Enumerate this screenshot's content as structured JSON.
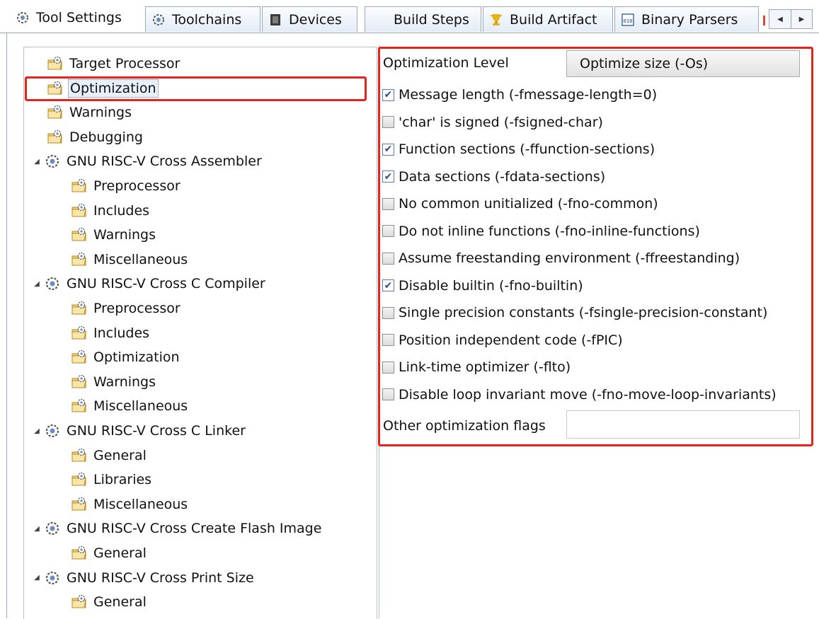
{
  "tabs": [
    {
      "label": "Tool Settings",
      "icon": "gear-folder-icon",
      "active": true
    },
    {
      "label": "Toolchains",
      "icon": "gear-icon"
    },
    {
      "label": "Devices",
      "icon": "chip-icon"
    },
    {
      "label": "Build Steps",
      "icon": ""
    },
    {
      "label": "Build Artifact",
      "icon": "trophy-icon"
    },
    {
      "label": "Binary Parsers",
      "icon": "binary-icon"
    }
  ],
  "tree": {
    "items": [
      {
        "label": "Target Processor",
        "level": 1
      },
      {
        "label": "Optimization",
        "level": 1,
        "selected": true
      },
      {
        "label": "Warnings",
        "level": 1
      },
      {
        "label": "Debugging",
        "level": 1
      },
      {
        "label": "GNU RISC-V Cross Assembler",
        "level": 0,
        "expanded": true
      },
      {
        "label": "Preprocessor",
        "level": 2
      },
      {
        "label": "Includes",
        "level": 2
      },
      {
        "label": "Warnings",
        "level": 2
      },
      {
        "label": "Miscellaneous",
        "level": 2
      },
      {
        "label": "GNU RISC-V Cross C Compiler",
        "level": 0,
        "expanded": true
      },
      {
        "label": "Preprocessor",
        "level": 2
      },
      {
        "label": "Includes",
        "level": 2
      },
      {
        "label": "Optimization",
        "level": 2
      },
      {
        "label": "Warnings",
        "level": 2
      },
      {
        "label": "Miscellaneous",
        "level": 2
      },
      {
        "label": "GNU RISC-V Cross C Linker",
        "level": 0,
        "expanded": true
      },
      {
        "label": "General",
        "level": 2
      },
      {
        "label": "Libraries",
        "level": 2
      },
      {
        "label": "Miscellaneous",
        "level": 2
      },
      {
        "label": "GNU RISC-V Cross Create Flash Image",
        "level": 0,
        "expanded": true
      },
      {
        "label": "General",
        "level": 2
      },
      {
        "label": "GNU RISC-V Cross Print Size",
        "level": 0,
        "expanded": true
      },
      {
        "label": "General",
        "level": 2
      }
    ]
  },
  "optimization": {
    "level_label": "Optimization Level",
    "level_value": "Optimize size (-Os)",
    "options": [
      {
        "label": "Message length (-fmessage-length=0)",
        "checked": true
      },
      {
        "label": "'char' is signed (-fsigned-char)",
        "checked": false
      },
      {
        "label": "Function sections (-ffunction-sections)",
        "checked": true
      },
      {
        "label": "Data sections (-fdata-sections)",
        "checked": true
      },
      {
        "label": "No common unitialized (-fno-common)",
        "checked": false
      },
      {
        "label": "Do not inline functions (-fno-inline-functions)",
        "checked": false
      },
      {
        "label": "Assume freestanding environment (-ffreestanding)",
        "checked": false
      },
      {
        "label": "Disable builtin (-fno-builtin)",
        "checked": true
      },
      {
        "label": "Single precision constants (-fsingle-precision-constant)",
        "checked": false
      },
      {
        "label": "Position independent code (-fPIC)",
        "checked": false
      },
      {
        "label": "Link-time optimizer (-flto)",
        "checked": false
      },
      {
        "label": "Disable loop invariant move (-fno-move-loop-invariants)",
        "checked": false
      }
    ],
    "other_flags_label": "Other optimization flags",
    "other_flags_value": ""
  },
  "colors": {
    "highlight": "#e8231d",
    "border": "#9aa7b6"
  }
}
